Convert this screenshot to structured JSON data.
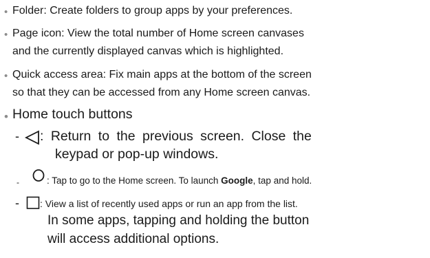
{
  "items": [
    {
      "line1": "Folder: Create folders to group apps by your preferences."
    },
    {
      "line1": "Page icon: View the total number of Home screen canvases",
      "line2": "and the currently displayed canvas which is highlighted."
    },
    {
      "line1": "Quick access area: Fix main apps at the bottom of the screen",
      "line2": "so that they can be accessed from any Home screen canvas."
    }
  ],
  "home_touch": {
    "heading": "Home touch buttons",
    "back": {
      "dash": "-",
      "line1": ": Return to the previous screen. Close the",
      "line2": "keypad or pop-up windows."
    },
    "home": {
      "dash": "-",
      "text_before": ": Tap to go to the Home screen. To launch ",
      "bold": "Google",
      "text_after": ", tap and hold."
    },
    "recent": {
      "dash": "-",
      "line1": ": View a list of recently used apps or run an app from the list.",
      "line2": "In some apps, tapping and holding the button",
      "line3": "will access additional options."
    }
  },
  "icons": {
    "back": "back-triangle-icon",
    "home": "home-circle-icon",
    "recent": "recent-apps-square-icon"
  }
}
